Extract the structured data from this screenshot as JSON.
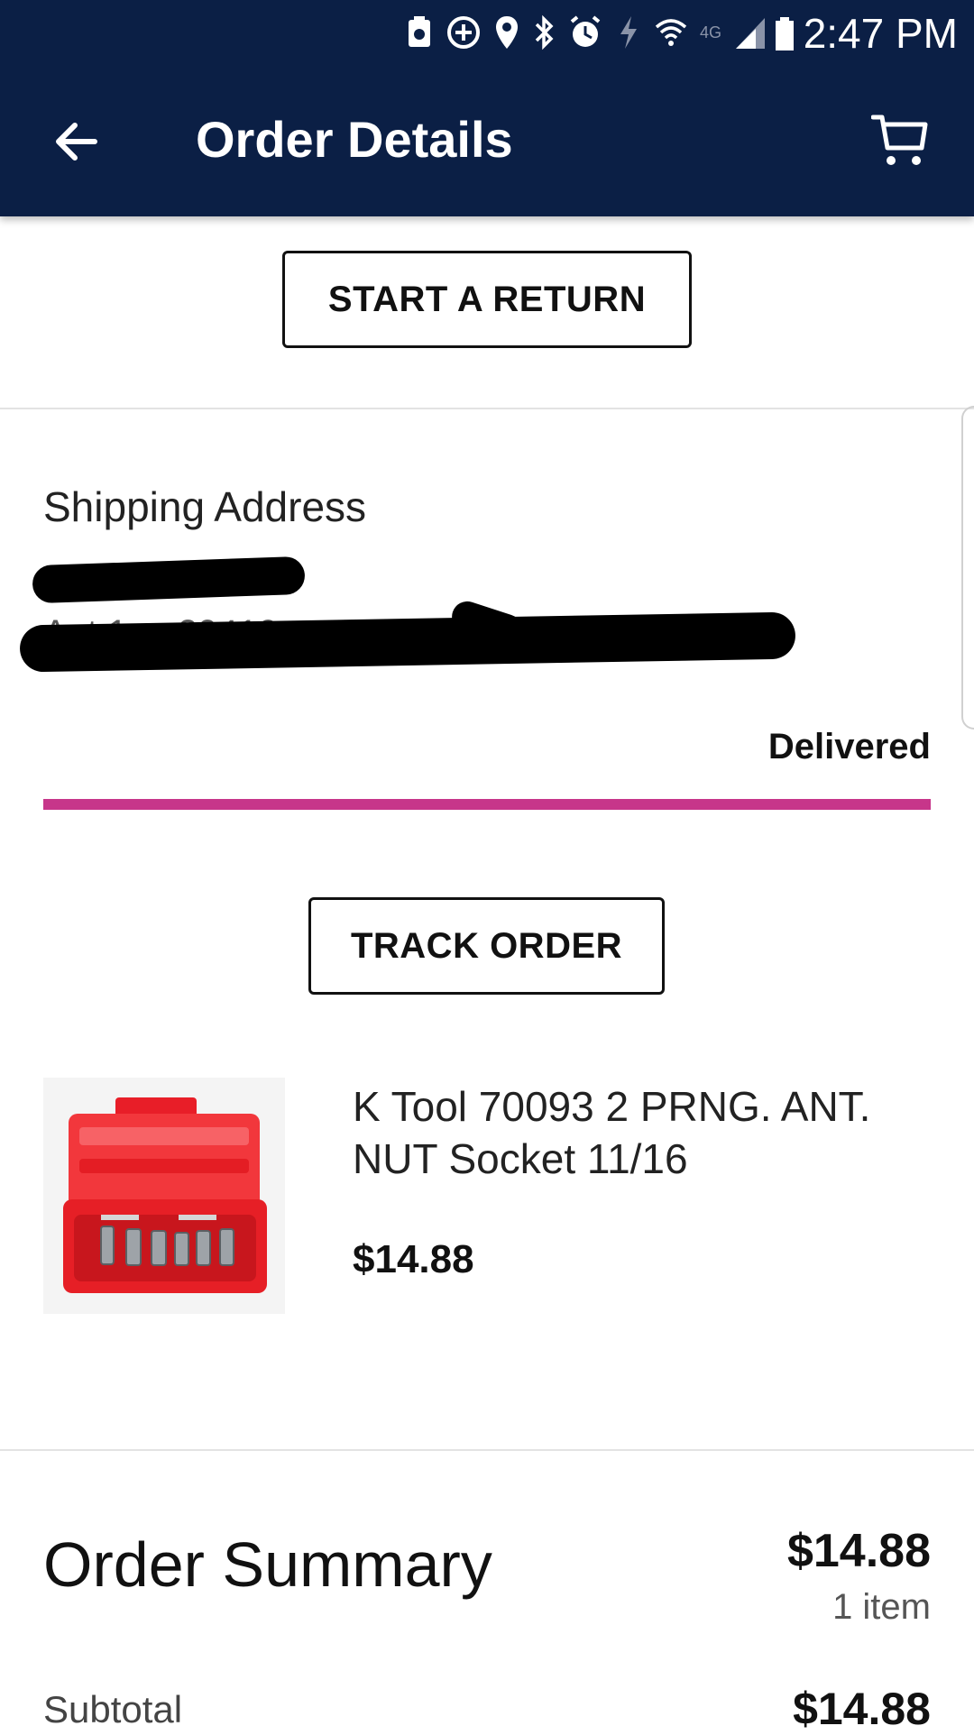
{
  "status_bar": {
    "time": "2:47 PM",
    "network_label": "4G"
  },
  "app_bar": {
    "title": "Order Details",
    "back_icon": "arrow-left-icon",
    "cart_icon": "cart-icon"
  },
  "actions": {
    "start_return": "START A RETURN",
    "track_order": "TRACK ORDER"
  },
  "shipping": {
    "title": "Shipping Address",
    "address_line_1": "",
    "address_line_2": "Apt 1 ... 29410"
  },
  "order_status": {
    "label": "Delivered",
    "progress": 1.0,
    "color": "#c7368a"
  },
  "product": {
    "name": "K Tool 70093 2 PRNG. ANT. NUT Socket 11/16",
    "price": "$14.88",
    "image_icon": "socket-set-case-image"
  },
  "summary": {
    "title": "Order Summary",
    "total": "$14.88",
    "item_count": "1 item",
    "subtotal_label": "Subtotal",
    "subtotal_value": "$14.88"
  },
  "colors": {
    "header_bg": "#0b1f45",
    "accent": "#c7368a"
  }
}
